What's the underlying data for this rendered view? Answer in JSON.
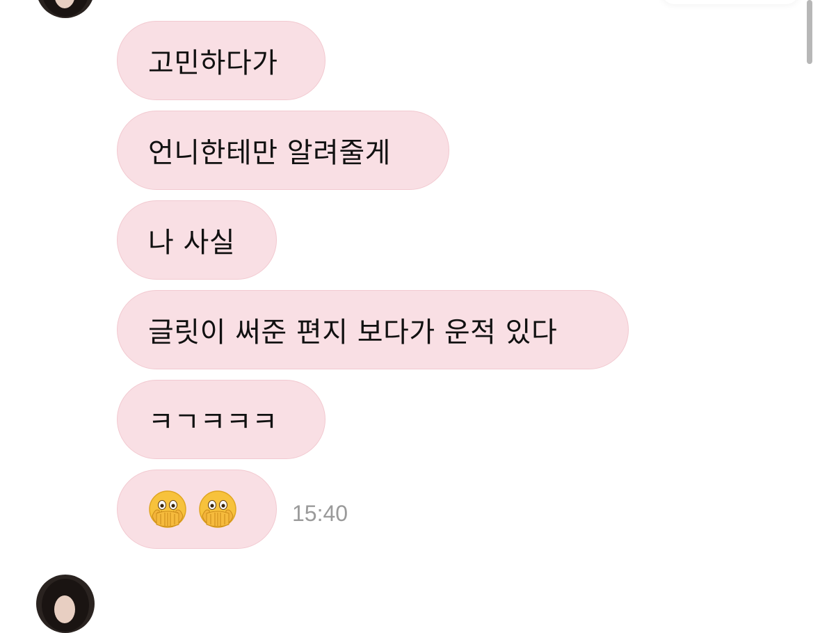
{
  "messages": [
    {
      "text": "고민하다가"
    },
    {
      "text": "언니한테만 알려줄게"
    },
    {
      "text": "나 사실"
    },
    {
      "text": "글릿이 써준 편지 보다가 운적 있다"
    },
    {
      "text": "ㅋㄱㅋㅋㅋ"
    },
    {
      "emoji": [
        "face-with-open-eyes-and-hand-over-mouth-emoji",
        "face-with-open-eyes-and-hand-over-mouth-emoji"
      ]
    }
  ],
  "timestamp": "15:40",
  "colors": {
    "bubble_background": "#f9dfe4",
    "bubble_border": "#f2c9d0",
    "timestamp_text": "#9a9a9a",
    "scrollbar": "#b7b7b7"
  }
}
